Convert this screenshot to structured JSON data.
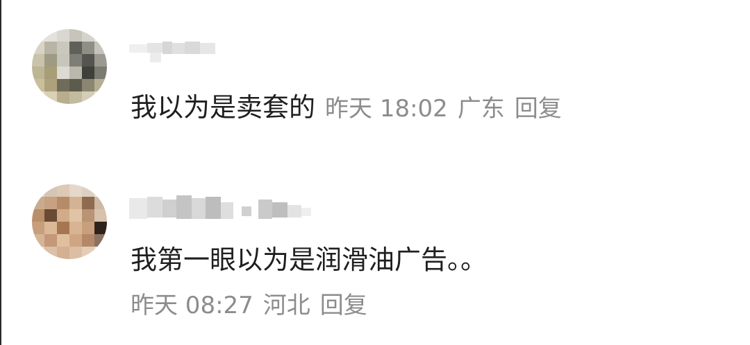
{
  "comments": [
    {
      "text": "我以为是卖套的",
      "time": "昨天 18:02",
      "location": "广东",
      "reply_label": "回复"
    },
    {
      "text": "我第一眼以为是润滑油广告。。",
      "time": "昨天 08:27",
      "location": "河北",
      "reply_label": "回复"
    }
  ]
}
